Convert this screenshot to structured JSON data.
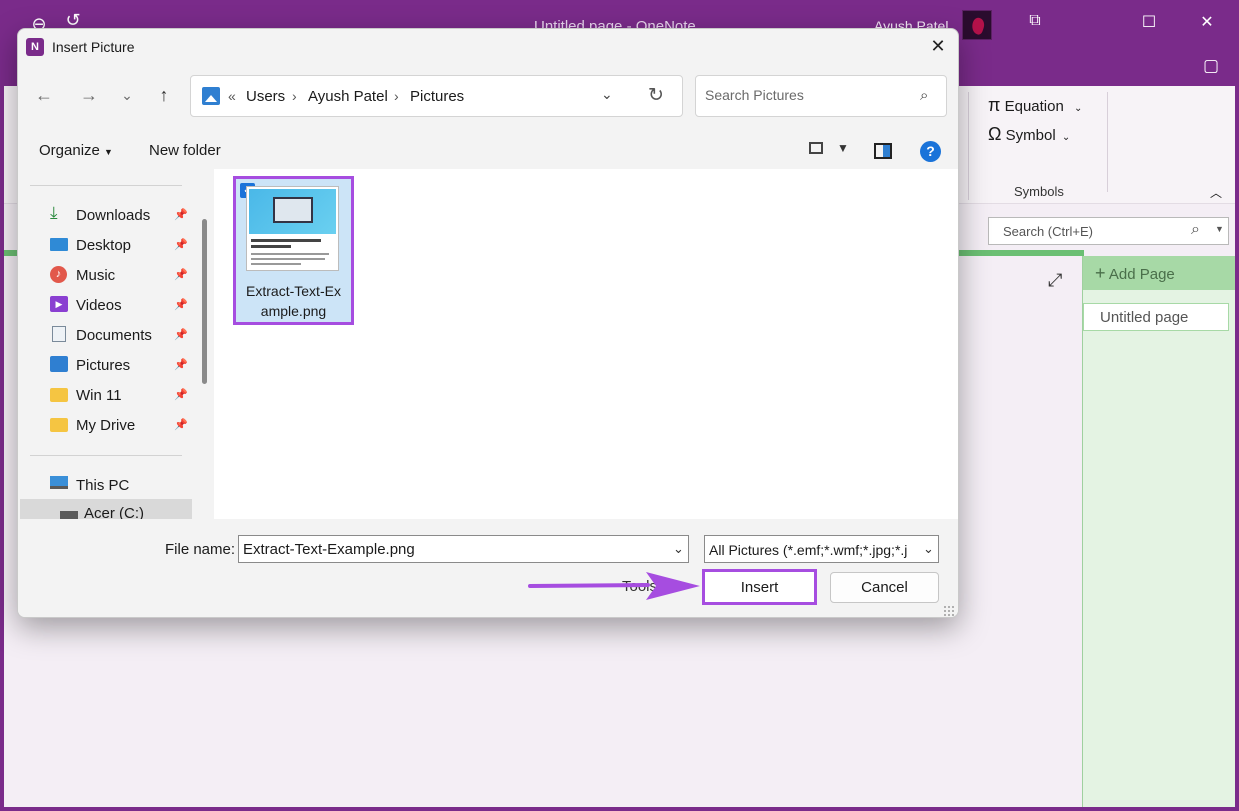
{
  "onenote": {
    "title": "Untitled page - OneNote",
    "user_name": "Ayush Patel",
    "ribbon": {
      "equation_label": "Equation",
      "symbol_label": "Symbol",
      "group_label": "Symbols"
    },
    "search_placeholder": "Search (Ctrl+E)",
    "add_page_label": "Add Page",
    "page_item_label": "Untitled page"
  },
  "dialog": {
    "title": "Insert Picture",
    "breadcrumb": [
      "Users",
      "Ayush Patel",
      "Pictures"
    ],
    "search_placeholder": "Search Pictures",
    "toolbar": {
      "organize_label": "Organize",
      "new_folder_label": "New folder"
    },
    "nav_items": [
      {
        "label": "Downloads",
        "icon": "download-icon",
        "pinned": true
      },
      {
        "label": "Desktop",
        "icon": "desktop-icon",
        "pinned": true
      },
      {
        "label": "Music",
        "icon": "music-icon",
        "pinned": true
      },
      {
        "label": "Videos",
        "icon": "videos-icon",
        "pinned": true
      },
      {
        "label": "Documents",
        "icon": "documents-icon",
        "pinned": true
      },
      {
        "label": "Pictures",
        "icon": "pictures-icon",
        "pinned": true
      },
      {
        "label": "Win 11",
        "icon": "folder-icon",
        "pinned": true
      },
      {
        "label": "My Drive",
        "icon": "cloud-folder-icon",
        "pinned": true
      }
    ],
    "this_pc_label": "This PC",
    "drive_label": "Acer (C:)",
    "file": {
      "name_line1": "Extract-Text-Ex",
      "name_line2": "ample.png",
      "selected": true
    },
    "file_name_label": "File name:",
    "file_name_value": "Extract-Text-Example.png",
    "file_type_value": "All Pictures (*.emf;*.wmf;*.jpg;*.j",
    "tools_label": "Tools",
    "insert_label": "Insert",
    "cancel_label": "Cancel"
  },
  "colors": {
    "onenote_purple": "#7a2b8a",
    "highlight": "#a64de0",
    "accent_blue": "#1a73d9",
    "page_green": "#a7d9a6"
  }
}
